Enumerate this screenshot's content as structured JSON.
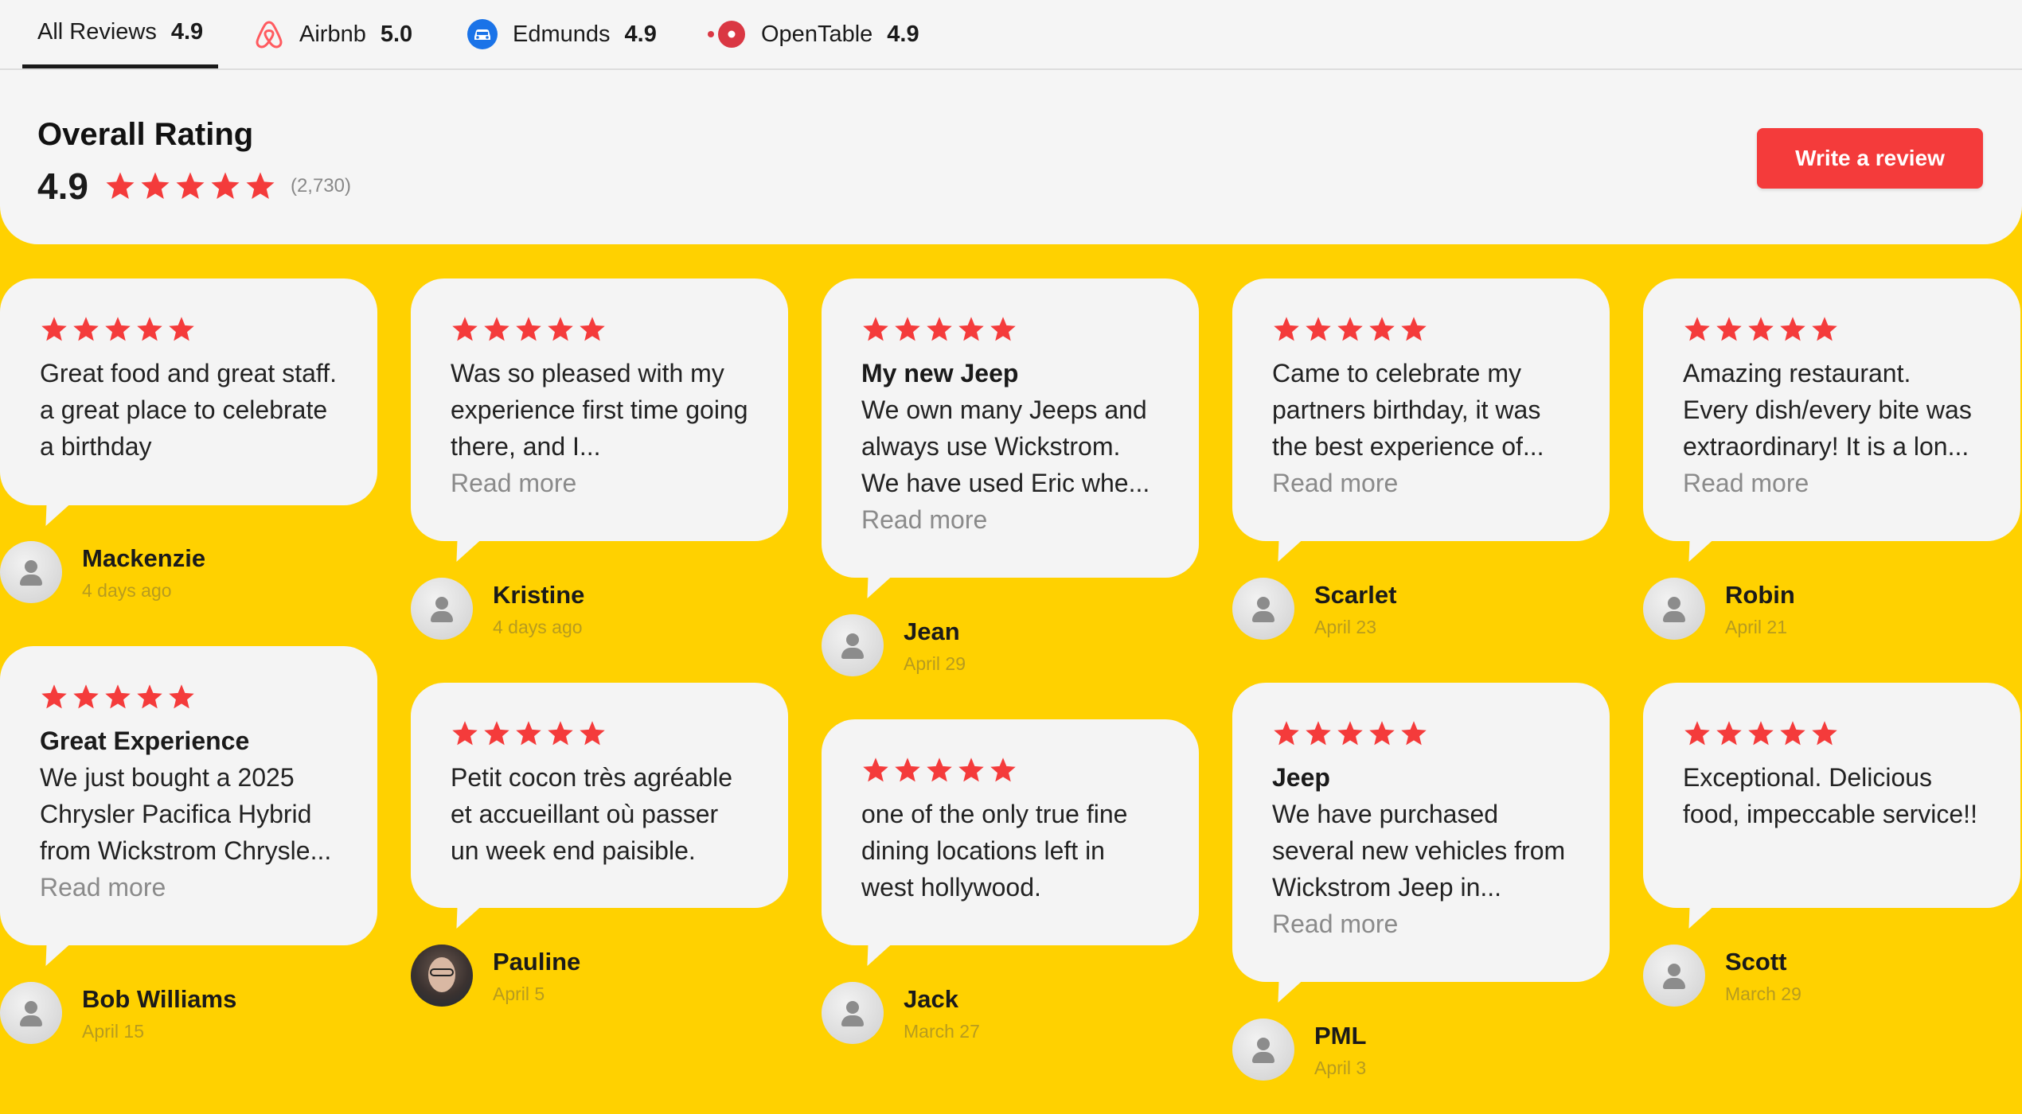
{
  "tabs": [
    {
      "label": "All Reviews",
      "score": "4.9",
      "icon": "",
      "active": true
    },
    {
      "label": "Airbnb",
      "score": "5.0",
      "icon": "airbnb-icon"
    },
    {
      "label": "Edmunds",
      "score": "4.9",
      "icon": "edmunds-icon"
    },
    {
      "label": "OpenTable",
      "score": "4.9",
      "icon": "opentable-icon"
    }
  ],
  "overall": {
    "title": "Overall Rating",
    "score": "4.9",
    "count": "(2,730)",
    "stars": 5
  },
  "write_review_label": "Write a review",
  "colors": {
    "accent": "#F43B3B",
    "background": "#FFD100",
    "card": "#F4F4F4",
    "airbnb": "#FF5A5F",
    "edmunds": "#1A73E8",
    "opentable": "#DA3743"
  },
  "reviews": [
    {
      "stars": 5,
      "title": "",
      "text": "Great food and great staff. a great place to celebrate a birthday",
      "read_more": "",
      "author": "Mackenzie",
      "date": "4 days ago",
      "avatar": "default"
    },
    {
      "stars": 5,
      "title": "Great Experience",
      "text": "We just bought a 2025 Chrysler Pacifica Hybrid from Wickstrom Chrysle...",
      "read_more": "Read more",
      "author": "Bob Williams",
      "date": "April 15",
      "avatar": "default"
    },
    {
      "stars": 5,
      "title": "",
      "text": "Was so pleased with my experience first time going there, and I...",
      "read_more": "Read more",
      "author": "Kristine",
      "date": "4 days ago",
      "avatar": "default"
    },
    {
      "stars": 5,
      "title": "",
      "text": "Petit cocon très agréable et accueillant où passer un week end paisible.",
      "read_more": "",
      "author": "Pauline",
      "date": "April 5",
      "avatar": "photo"
    },
    {
      "stars": 5,
      "title": "My new Jeep",
      "text": "We own many Jeeps and always use Wickstrom. We have used Eric whe...",
      "read_more": "Read more",
      "author": "Jean",
      "date": "April 29",
      "avatar": "default"
    },
    {
      "stars": 5,
      "title": "",
      "text": "one of the only true fine dining locations left in west hollywood.",
      "read_more": "",
      "author": "Jack",
      "date": "March 27",
      "avatar": "default"
    },
    {
      "stars": 5,
      "title": "",
      "text": "Came to celebrate my partners birthday, it was the best experience of...",
      "read_more": "Read more",
      "author": "Scarlet",
      "date": "April 23",
      "avatar": "default"
    },
    {
      "stars": 5,
      "title": "Jeep",
      "text": "We have purchased several new vehicles from Wickstrom Jeep in...",
      "read_more": "Read more",
      "author": "PML",
      "date": "April 3",
      "avatar": "default"
    },
    {
      "stars": 5,
      "title": "",
      "text": "Amazing restaurant. Every dish/every bite was extraordinary! It is a lon...",
      "read_more": "Read more",
      "author": "Robin",
      "date": "April 21",
      "avatar": "default"
    },
    {
      "stars": 5,
      "title": "",
      "text": "Exceptional. Delicious food, impeccable service!!",
      "read_more": "",
      "author": "Scott",
      "date": "March 29",
      "avatar": "default"
    }
  ]
}
